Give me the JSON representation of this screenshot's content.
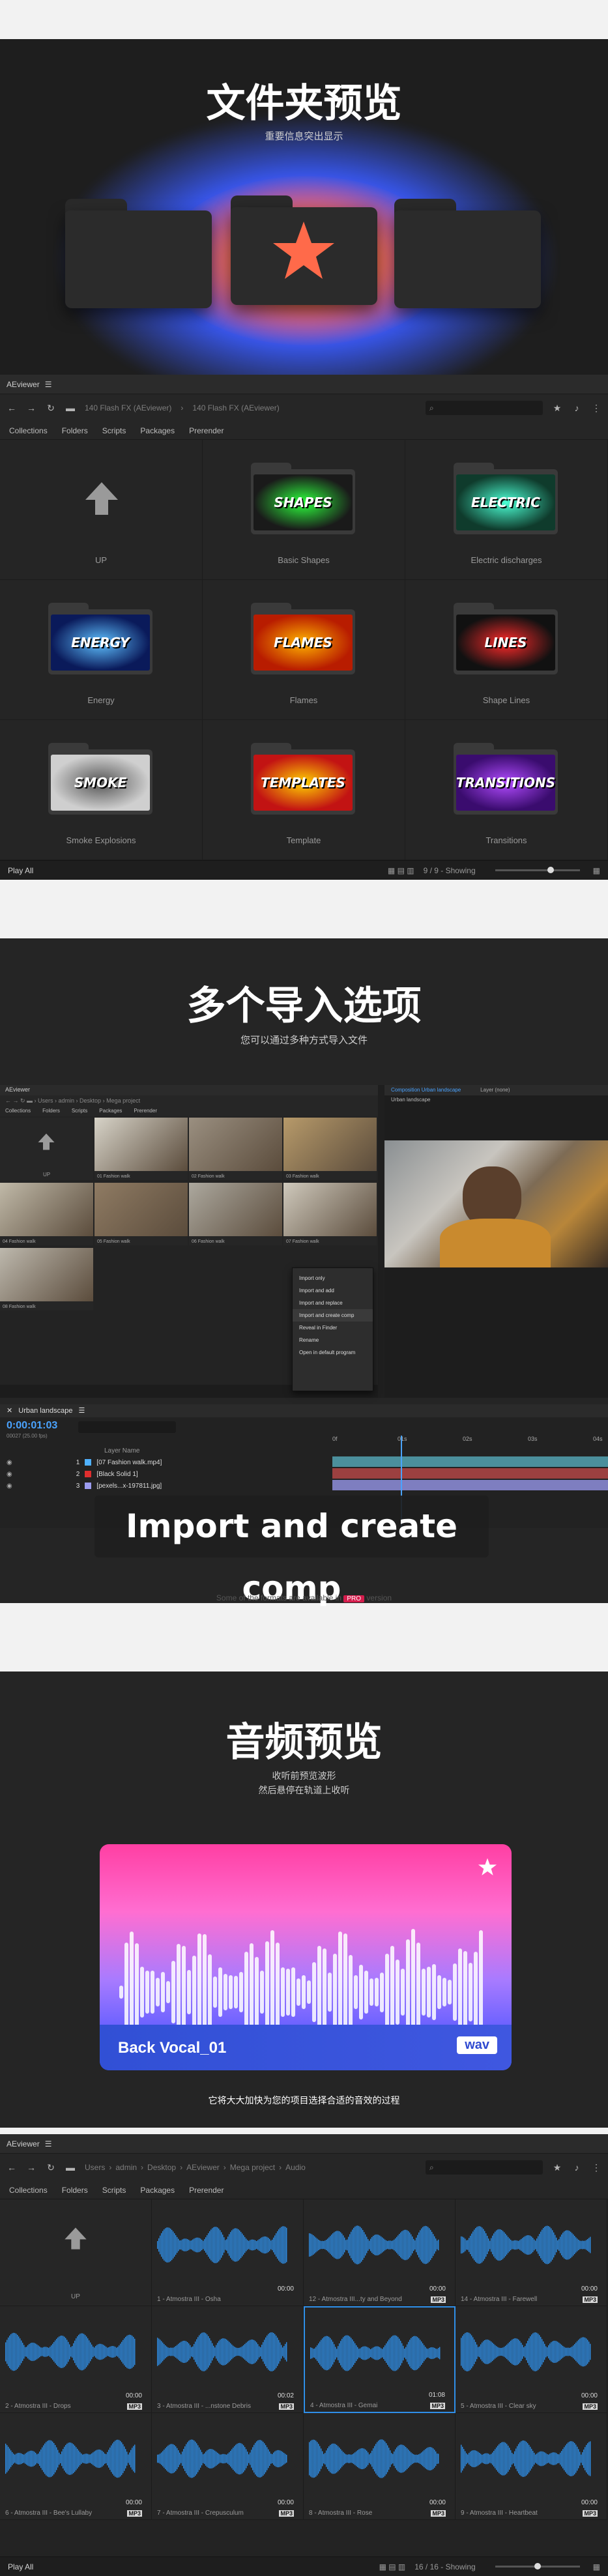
{
  "hero1": {
    "title": "文件夹预览",
    "subtitle": "重要信息突出显示"
  },
  "app1": {
    "window_title": "AEviewer",
    "breadcrumb": [
      "140 Flash FX (AEviewer)",
      "140 Flash FX (AEviewer)"
    ],
    "menu": [
      "Collections",
      "Folders",
      "Scripts",
      "Packages",
      "Prerender"
    ],
    "folders": [
      {
        "label": "UP",
        "art": ""
      },
      {
        "label": "Basic Shapes",
        "art": "SHAPES",
        "color": "#1a1a1a",
        "accent": "#2cff3c"
      },
      {
        "label": "Electric discharges",
        "art": "ELECTRIC",
        "color": "#0f3b2c",
        "accent": "#4bffd4"
      },
      {
        "label": "Energy",
        "art": "ENERGY",
        "color": "#0a1a5a",
        "accent": "#5ec0ff"
      },
      {
        "label": "Flames",
        "art": "FLAMES",
        "color": "#b81c00",
        "accent": "#ffb300"
      },
      {
        "label": "Shape Lines",
        "art": "LINES",
        "color": "#111111",
        "accent": "#ff2a2a"
      },
      {
        "label": "Smoke Explosions",
        "art": "SMOKE",
        "color": "#cfcfcf",
        "accent": "#555555"
      },
      {
        "label": "Template",
        "art": "TEMPLATES",
        "color": "#c21313",
        "accent": "#ffd200"
      },
      {
        "label": "Transitions",
        "art": "TRANSITIONS",
        "color": "#3a0c6e",
        "accent": "#b14bff"
      }
    ],
    "status": {
      "play_all": "Play All",
      "count": "9 / 9 - Showing"
    }
  },
  "hero2": {
    "title": "多个导入选项",
    "subtitle": "您可以通过多种方式导入文件",
    "banner": "Import and create comp",
    "note_prefix": "Some of the formats are available in",
    "pro": "PRO",
    "note_suffix": "version",
    "app": {
      "window_title": "AEviewer",
      "menu": [
        "Collections",
        "Folders",
        "Scripts",
        "Packages",
        "Prerender"
      ],
      "up": "UP",
      "clips": [
        "01 Fashion walk",
        "02 Fashion walk",
        "03 Fashion walk",
        "04 Fashion walk",
        "05 Fashion walk",
        "06 Fashion walk",
        "07 Fashion walk",
        "08 Fashion walk"
      ],
      "context_menu": [
        "Import only",
        "Import and add",
        "Import and replace",
        "Import and create comp",
        "Reveal in Finder",
        "Rename",
        "Open in default program"
      ],
      "comp_tab": "Composition Urban landscape",
      "comp_tab2": "Layer (none)",
      "comp_label": "Urban landscape"
    },
    "timeline": {
      "tab": "Urban landscape",
      "timecode": "0:00:01:03",
      "frames": "00027 (25.00 fps)",
      "col_header": "Layer Name",
      "layers": [
        {
          "num": "1",
          "name": "[07 Fashion walk.mp4]",
          "color": "#4fb1ff"
        },
        {
          "num": "2",
          "name": "[Black Solid 1]",
          "color": "#e02e2e"
        },
        {
          "num": "3",
          "name": "[pexels...x-197811.jpg]",
          "color": "#9c9cf0"
        }
      ],
      "ruler": [
        "0f",
        "01s",
        "02s",
        "03s",
        "04s"
      ]
    }
  },
  "hero3": {
    "title": "音频预览",
    "subtitle1": "收听前预览波形",
    "subtitle2": "然后悬停在轨道上收听",
    "card_title": "Back Vocal_01",
    "card_badge": "wav",
    "caption": "它将大大加快为您的项目选择合适的音效的过程"
  },
  "app3": {
    "window_title": "AEviewer",
    "breadcrumb": [
      "Users",
      "admin",
      "Desktop",
      "AEviewer",
      "Mega project",
      "Audio"
    ],
    "menu": [
      "Collections",
      "Folders",
      "Scripts",
      "Packages",
      "Prerender"
    ],
    "up": "UP",
    "tracks": [
      {
        "label": "1 - Atmostra III - Osha",
        "time": "00:00",
        "tag": ""
      },
      {
        "label": "12 - Atmostra III...ty and Beyond",
        "time": "00:00",
        "tag": "MP3"
      },
      {
        "label": "14 - Atmostra III - Farewell",
        "time": "00:00",
        "tag": "MP3"
      },
      {
        "label": "2 - Atmostra III - Drops",
        "time": "00:00",
        "tag": "MP3"
      },
      {
        "label": "3 - Atmostra III - ...nstone Debris",
        "time": "00:02",
        "tag": "MP3"
      },
      {
        "label": "4 - Atmostra III - Gemai",
        "time": "01:08",
        "tag": "MP3"
      },
      {
        "label": "5 - Atmostra III - Clear sky",
        "time": "00:00",
        "tag": "MP3"
      },
      {
        "label": "6 - Atmostra III - Bee's Lullaby",
        "time": "00:00",
        "tag": "MP3"
      },
      {
        "label": "7 - Atmostra III - Crepusculum",
        "time": "00:00",
        "tag": "MP3"
      },
      {
        "label": "8 - Atmostra III - Rose",
        "time": "00:00",
        "tag": "MP3"
      },
      {
        "label": "9 - Atmostra III - Heartbeat",
        "time": "00:00",
        "tag": "MP3"
      }
    ],
    "status": {
      "play_all": "Play All",
      "count": "16 / 16 - Showing"
    }
  }
}
